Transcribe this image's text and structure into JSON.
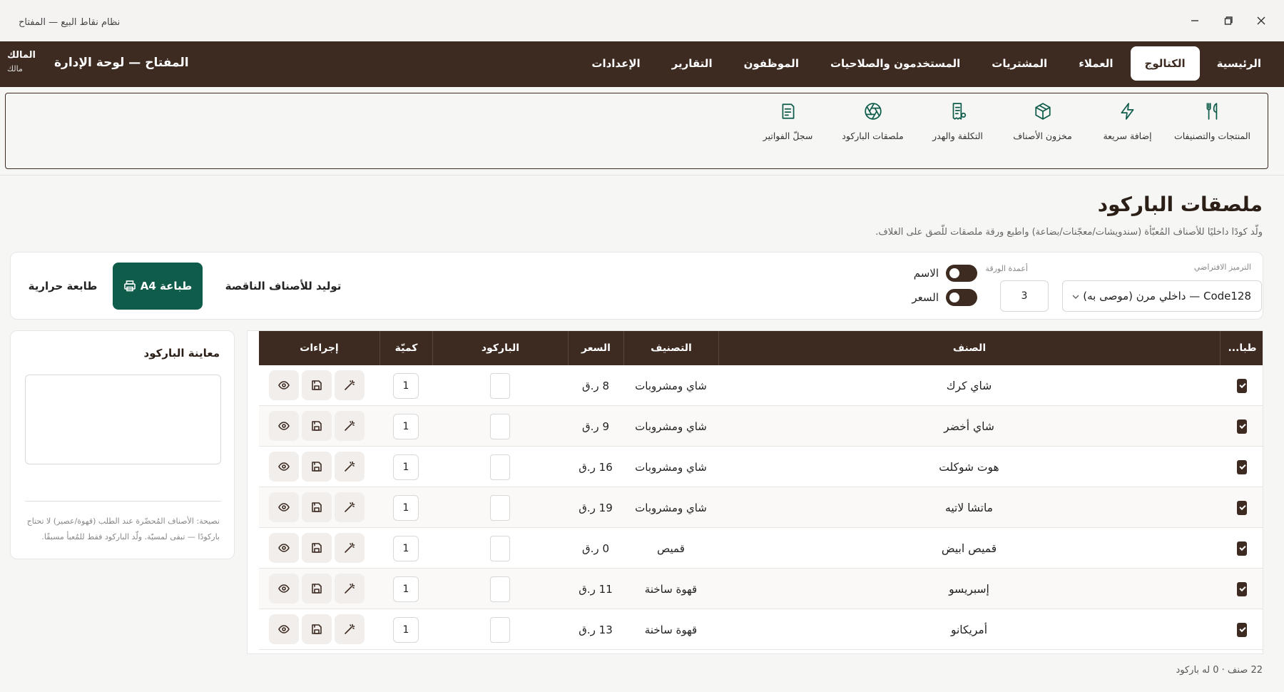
{
  "window": {
    "title": "نظام نقاط البيع — المفتاح"
  },
  "navbar": {
    "brand": "المفتاح — لوحة الإدارة",
    "user_name": "المالك",
    "user_role": "مالك",
    "tabs": [
      {
        "label": "الرئيسية"
      },
      {
        "label": "الكتالوج",
        "active": true
      },
      {
        "label": "العملاء"
      },
      {
        "label": "المشتريات"
      },
      {
        "label": "المستخدمون والصلاحيات"
      },
      {
        "label": "الموظفون"
      },
      {
        "label": "التقارير"
      },
      {
        "label": "الإعدادات"
      }
    ]
  },
  "subnav": {
    "items": [
      {
        "label": "المنتجات والتصنيفات",
        "icon": "utensils-icon"
      },
      {
        "label": "إضافة سريعة",
        "icon": "bolt-icon"
      },
      {
        "label": "مخزون الأصناف",
        "icon": "box-icon"
      },
      {
        "label": "التكلفة والهدر",
        "icon": "receipt-icon"
      },
      {
        "label": "ملصقات الباركود",
        "icon": "aperture-icon"
      },
      {
        "label": "سجلّ الفواتير",
        "icon": "document-icon"
      }
    ]
  },
  "page": {
    "title": "ملصقات الباركود",
    "subtitle": "ولّد كودًا داخليًا للأصناف المُعبّأة (سندويشات/معجّنات/بضاعة) واطبع ورقة ملصقات للّصق على الغلاف."
  },
  "controls": {
    "encoding_label": "الترميز الافتراضي",
    "encoding_value": "Code128 — داخلي مرن (موصى به)",
    "columns_label": "أعمدة الورقة",
    "columns_value": "3",
    "toggle_name_label": "الاسم",
    "toggle_price_label": "السعر",
    "generate_label": "توليد للأصناف الناقصة",
    "print_a4_label": "طباعة A4",
    "thermal_label": "طابعة حرارية"
  },
  "preview": {
    "title": "معاينة الباركود",
    "tip": "نصيحة: الأصناف المُحضّرة عند الطلب (قهوة/عصير) لا تحتاج باركودًا — تبقى لمسيّة. ولّد الباركود فقط للمُعبأ مسبقًا."
  },
  "table": {
    "headers": {
      "print": "طبا...",
      "item": "الصنف",
      "category": "التصنيف",
      "price": "السعر",
      "barcode": "الباركود",
      "qty": "كميّة",
      "actions": "إجراءات"
    },
    "rows": [
      {
        "item": "شاي كرك",
        "category": "شاي ومشروبات",
        "price": "8 ر.ق",
        "qty": "1"
      },
      {
        "item": "شاي أخضر",
        "category": "شاي ومشروبات",
        "price": "9 ر.ق",
        "qty": "1"
      },
      {
        "item": "هوت شوكلت",
        "category": "شاي ومشروبات",
        "price": "16 ر.ق",
        "qty": "1"
      },
      {
        "item": "ماتشا لاتيه",
        "category": "شاي ومشروبات",
        "price": "19 ر.ق",
        "qty": "1"
      },
      {
        "item": "قميص ابيض",
        "category": "قميص",
        "price": "0 ر.ق",
        "qty": "1"
      },
      {
        "item": "إسبريسو",
        "category": "قهوة ساخنة",
        "price": "11 ر.ق",
        "qty": "1"
      },
      {
        "item": "أمريكانو",
        "category": "قهوة ساخنة",
        "price": "13 ر.ق",
        "qty": "1"
      }
    ]
  },
  "footer": {
    "count": "22 صنف · 0 له باركود"
  },
  "colors": {
    "primary_brown": "#3d2b22",
    "accent_green": "#0f5c4b"
  }
}
